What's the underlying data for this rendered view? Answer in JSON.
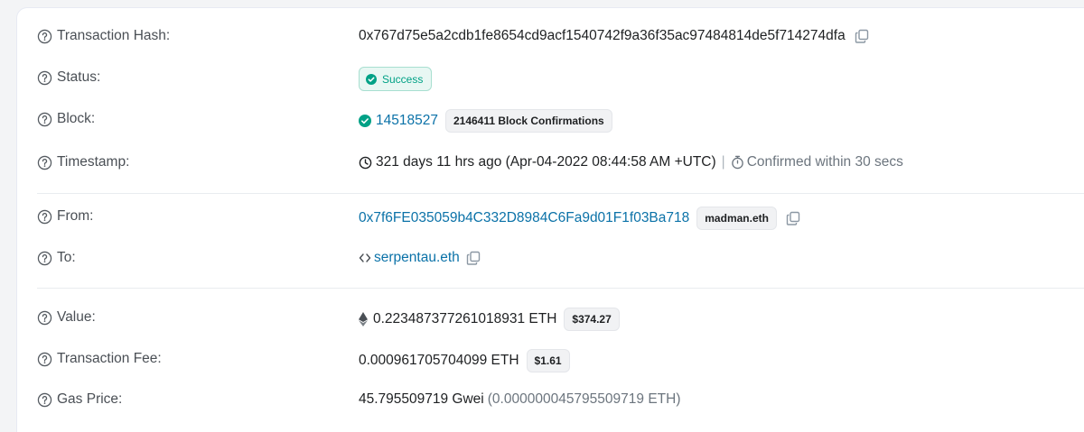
{
  "labels": {
    "tx_hash": "Transaction Hash:",
    "status": "Status:",
    "block": "Block:",
    "timestamp": "Timestamp:",
    "from": "From:",
    "to": "To:",
    "value": "Value:",
    "fee": "Transaction Fee:",
    "gas_price": "Gas Price:"
  },
  "tx_hash": "0x767d75e5a2cdb1fe8654cd9acf1540742f9a36f35ac97484814de5f714274dfa",
  "status": "Success",
  "block": {
    "number": "14518527",
    "confirmations": "2146411 Block Confirmations"
  },
  "timestamp": {
    "age": "321 days 11 hrs ago (Apr-04-2022 08:44:58 AM +UTC)",
    "separator": "|",
    "confirmed": "Confirmed within 30 secs"
  },
  "from": {
    "address": "0x7f6FE035059b4C332D8984C6Fa9d01F1f03Ba718",
    "name_tag": "madman.eth"
  },
  "to": {
    "contract": "serpentau.eth"
  },
  "value": {
    "amount": "0.223487377261018931 ETH",
    "usd": "$374.27"
  },
  "fee": {
    "amount": "0.000961705704099 ETH",
    "usd": "$1.61"
  },
  "gas_price": {
    "gwei": "45.795509719 Gwei",
    "eth": "(0.000000045795509719 ETH)"
  },
  "colors": {
    "link": "#0b72a8",
    "success": "#00a186"
  },
  "icons": {
    "help": "question-circle-icon",
    "copy": "copy-icon",
    "check": "check-circle-icon",
    "clock": "clock-icon",
    "stopwatch": "stopwatch-icon",
    "contract": "code-brackets-icon",
    "eth": "ethereum-icon"
  }
}
